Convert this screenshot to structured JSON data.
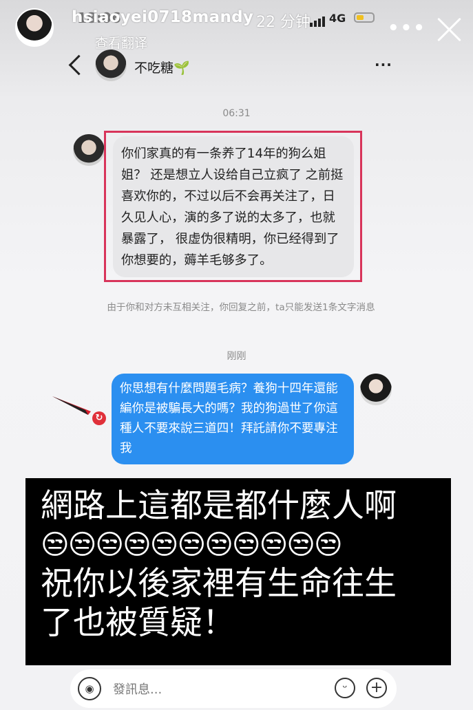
{
  "story": {
    "username": "hsiaoyei0718mandy",
    "time_ago": "22 分钟",
    "translate_label": "查看翻译",
    "more_label": "•••"
  },
  "status_bar": {
    "time": "18:06",
    "network": "4G"
  },
  "chat_header": {
    "name": "不吃糖",
    "name_emoji": "🌱",
    "more_label": "···"
  },
  "messages": {
    "timestamp_1": "06:31",
    "incoming": "你们家真的有一条养了14年的狗么姐姐？ 还是想立人设给自己立疯了 之前挺喜欢你的，不过以后不会再关注了，日久见人心，演的多了说的太多了，也就暴露了， 很虚伪很精明，你已经得到了你想要的，薅羊毛够多了。",
    "notice": "由于你和对方未互相关注，你回复之前，ta只能发送1条文字消息",
    "timestamp_2": "刚刚",
    "outgoing": "你思想有什麼問題毛病？養狗十四年還能編你是被騙長大的嗎？我的狗過世了你這種人不要來說三道四！拜託請你不要專注我"
  },
  "caption": {
    "line1": "網路上這都是都什麼人啊",
    "emoji_row": "😒😒😒😒😒😒😒😒😒😒😒",
    "line2": "祝你以後家裡有生命往生",
    "line3": "了也被質疑！"
  },
  "composer": {
    "placeholder": "發訊息..."
  },
  "icons": {
    "voice": "voice-icon",
    "emoji": "emoji-icon",
    "add": "plus-icon",
    "retry": "retry-icon",
    "close": "close-icon",
    "back": "back-icon"
  },
  "colors": {
    "outgoing_bubble": "#2b8ff0",
    "incoming_bubble": "#e7e7e9",
    "highlight": "#d8345a",
    "retry": "#e0303a"
  }
}
